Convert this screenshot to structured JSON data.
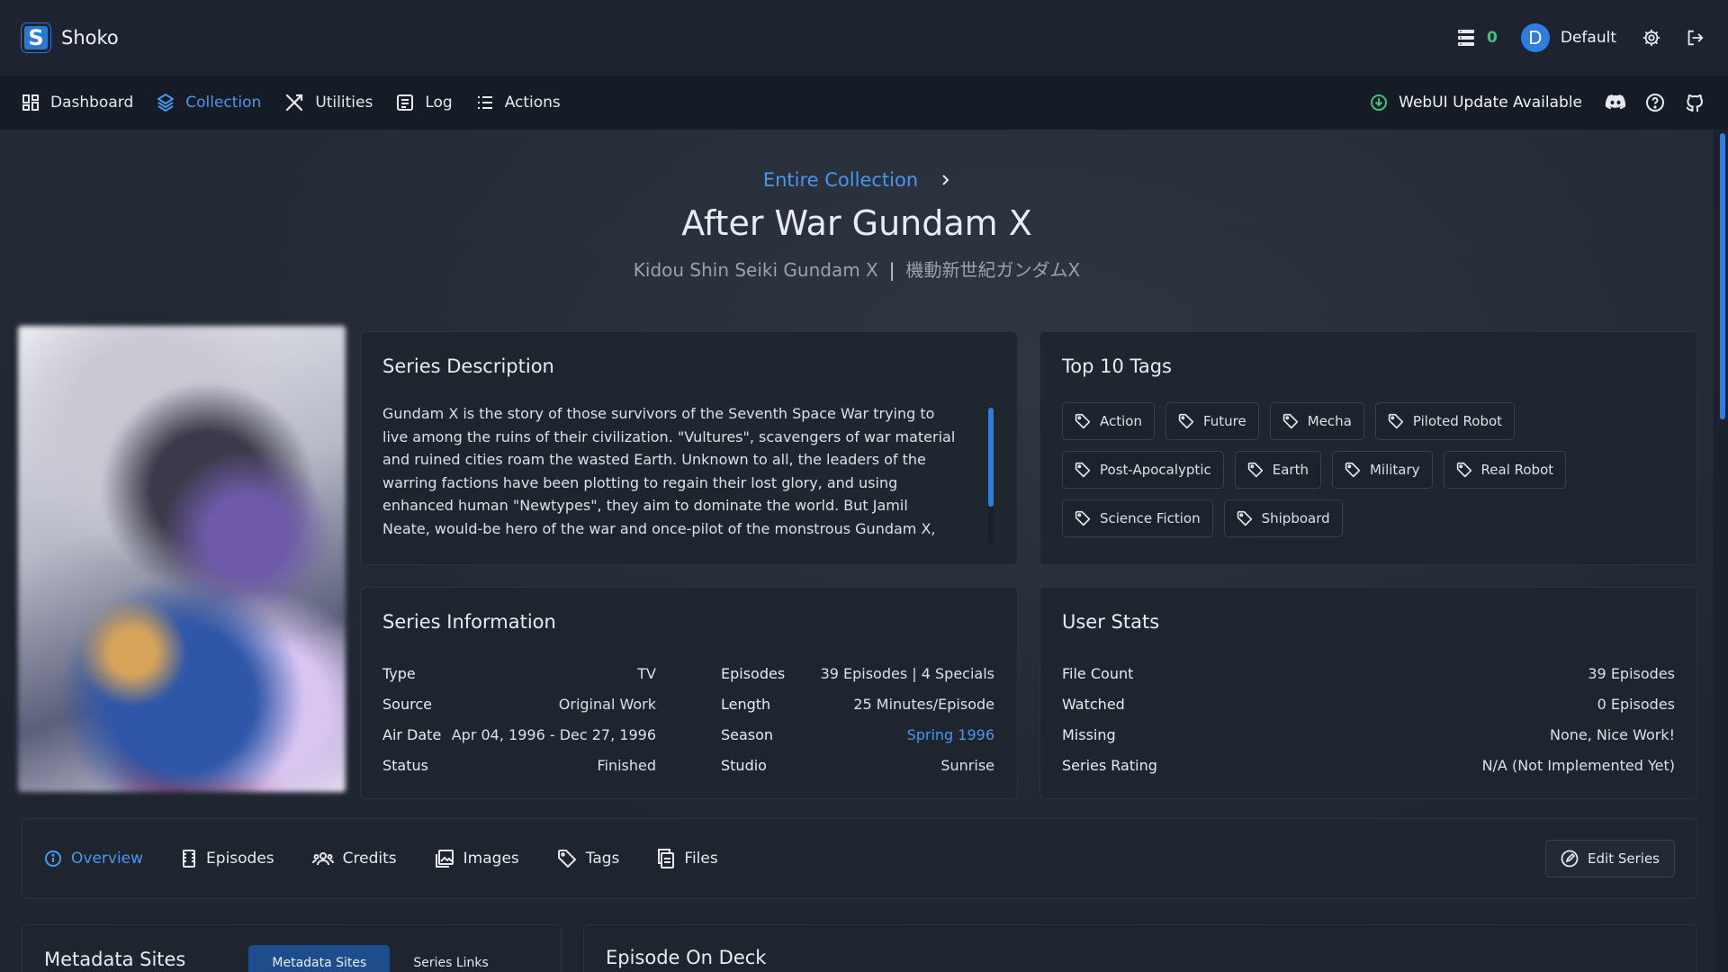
{
  "app": {
    "name": "Shoko",
    "logo_letter": "S"
  },
  "topbar": {
    "queue_count": "0",
    "avatar_letter": "D",
    "username": "Default"
  },
  "nav": {
    "items": [
      {
        "label": "Dashboard",
        "icon": "dashboard-icon"
      },
      {
        "label": "Collection",
        "icon": "collection-icon",
        "active": true
      },
      {
        "label": "Utilities",
        "icon": "utilities-icon"
      },
      {
        "label": "Log",
        "icon": "log-icon"
      },
      {
        "label": "Actions",
        "icon": "actions-icon"
      }
    ],
    "update_label": "WebUI Update Available"
  },
  "header": {
    "breadcrumb": "Entire Collection",
    "title": "After War Gundam X",
    "alt_title_romaji": "Kidou Shin Seiki Gundam X",
    "alt_title_separator": "|",
    "alt_title_japanese": "機動新世紀ガンダムX"
  },
  "description": {
    "title": "Series Description",
    "text": "Gundam X is the story of those survivors of the Seventh Space War trying to live among the ruins of their civilization. \"Vultures\", scavengers of war material and ruined cities roam the wasted Earth. Unknown to all, the leaders of the warring factions have been plotting to regain their lost glory, and using enhanced human \"Newtypes\", they aim to dominate the world. But Jamil Neate, would-be hero of the war and once-pilot of the monstrous Gundam X, the plucky teen Garrod Ran,"
  },
  "tags": {
    "title": "Top 10 Tags",
    "items": [
      "Action",
      "Future",
      "Mecha",
      "Piloted Robot",
      "Post-Apocalyptic",
      "Earth",
      "Military",
      "Real Robot",
      "Science Fiction",
      "Shipboard"
    ]
  },
  "info": {
    "title": "Series Information",
    "left": [
      {
        "label": "Type",
        "value": "TV"
      },
      {
        "label": "Source",
        "value": "Original Work"
      },
      {
        "label": "Air Date",
        "value": "Apr 04, 1996 - Dec 27, 1996"
      },
      {
        "label": "Status",
        "value": "Finished"
      }
    ],
    "right": [
      {
        "label": "Episodes",
        "value": "39 Episodes | 4 Specials"
      },
      {
        "label": "Length",
        "value": "25 Minutes/Episode"
      },
      {
        "label": "Season",
        "value": "Spring 1996"
      },
      {
        "label": "Studio",
        "value": "Sunrise"
      }
    ]
  },
  "stats": {
    "title": "User Stats",
    "rows": [
      {
        "label": "File Count",
        "value": "39 Episodes"
      },
      {
        "label": "Watched",
        "value": "0 Episodes"
      },
      {
        "label": "Missing",
        "value": "None, Nice Work!"
      },
      {
        "label": "Series Rating",
        "value": "N/A (Not Implemented Yet)"
      }
    ]
  },
  "tabs": {
    "items": [
      "Overview",
      "Episodes",
      "Credits",
      "Images",
      "Tags",
      "Files"
    ],
    "edit_label": "Edit Series"
  },
  "metadata": {
    "title": "Metadata Sites",
    "tab_sites": "Metadata Sites",
    "tab_links": "Series Links"
  },
  "deck": {
    "title": "Episode On Deck"
  },
  "colors": {
    "accent": "#4b96ee",
    "success": "#3cc47c",
    "background": "#1b222d"
  }
}
